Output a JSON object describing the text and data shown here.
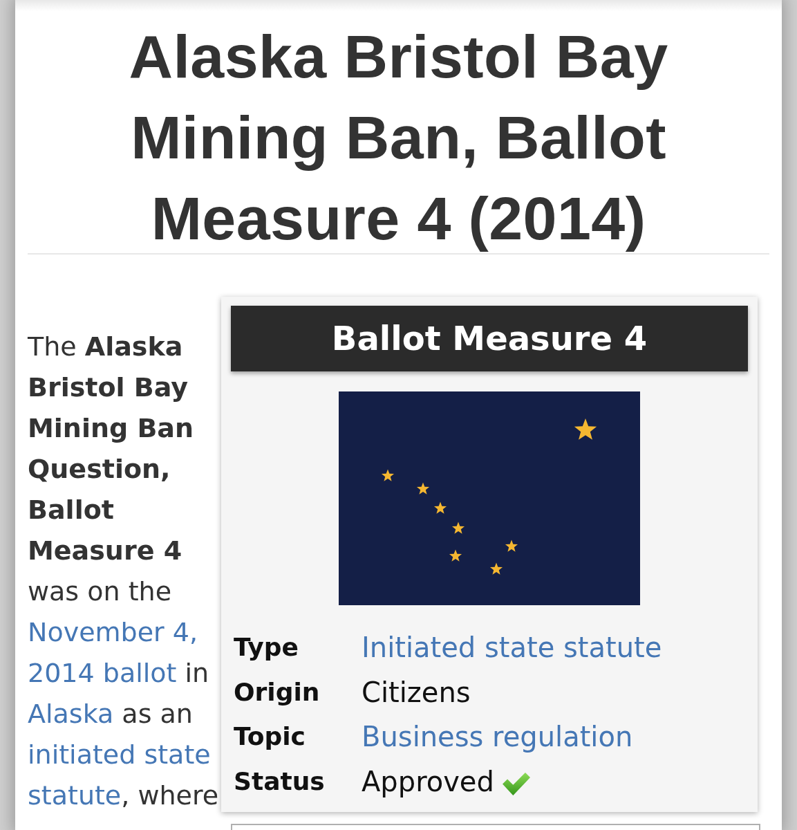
{
  "page": {
    "title": "Alaska Bristol Bay Mining Ban, Ballot Measure 4 (2014)"
  },
  "intro": {
    "segments": [
      {
        "kind": "text",
        "text": "The "
      },
      {
        "kind": "bold",
        "text": "Alaska Bristol Bay Mining Ban Question, Ballot Measure 4"
      },
      {
        "kind": "text",
        "text": " was on the "
      },
      {
        "kind": "link",
        "parts": [
          "November 4,",
          "2014 ballot"
        ]
      },
      {
        "kind": "text",
        "text": " in "
      },
      {
        "kind": "link",
        "parts": [
          "Alaska"
        ]
      },
      {
        "kind": "text",
        "text": " as an "
      },
      {
        "kind": "link",
        "parts": [
          "initiated state",
          "statute"
        ]
      },
      {
        "kind": "text",
        "text": ", where"
      }
    ]
  },
  "infobox": {
    "title": "Ballot Measure 4",
    "rows": [
      {
        "label": "Type",
        "value": "Initiated state statute",
        "kind": "link"
      },
      {
        "label": "Origin",
        "value": "Citizens",
        "kind": "text"
      },
      {
        "label": "Topic",
        "value": "Business regulation",
        "kind": "link"
      },
      {
        "label": "Status",
        "value": "Approved",
        "kind": "status"
      }
    ]
  }
}
